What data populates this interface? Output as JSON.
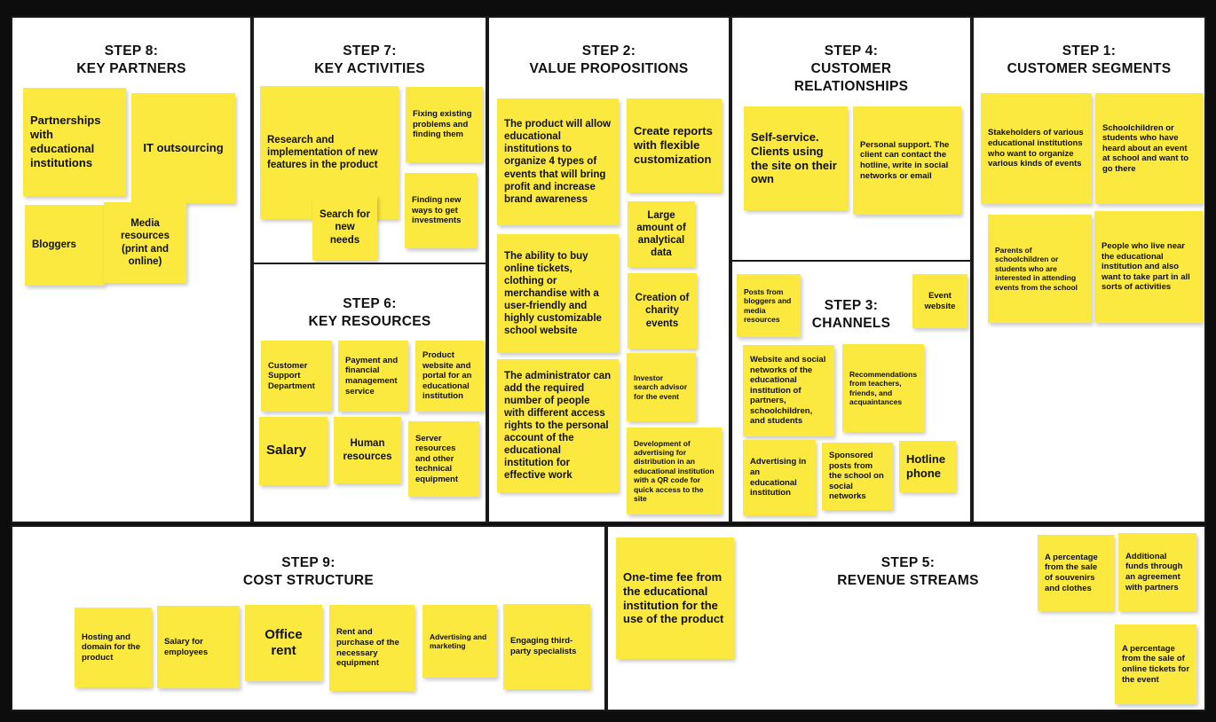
{
  "canvas": {
    "name": "Business Model Canvas",
    "note_color": "#fbe93f",
    "panel_bg": "#ffffff",
    "frame_color": "#0d0d0d"
  },
  "panels": [
    {
      "id": "step8",
      "title": "STEP 8:\nKEY PARTNERS",
      "notes": [
        {
          "text": "Partnerships with educational institutions"
        },
        {
          "text": "IT outsourcing"
        },
        {
          "text": "Bloggers"
        },
        {
          "text": "Media resources (print and online)"
        }
      ]
    },
    {
      "id": "step7",
      "title": "STEP 7:\nKEY ACTIVITIES",
      "notes": [
        {
          "text": "Research and implementation of new features in the product"
        },
        {
          "text": "Fixing existing problems and finding them"
        },
        {
          "text": "Search for new needs"
        },
        {
          "text": "Finding new ways to get investments"
        }
      ]
    },
    {
      "id": "step6",
      "title": "STEP 6:\nKEY RESOURCES",
      "notes": [
        {
          "text": "Customer Support Department"
        },
        {
          "text": "Payment and financial management service"
        },
        {
          "text": "Product website and portal for an educational institution"
        },
        {
          "text": "Salary"
        },
        {
          "text": "Human resources"
        },
        {
          "text": "Server resources and other technical equipment"
        }
      ]
    },
    {
      "id": "step2",
      "title": "STEP 2:\nVALUE PROPOSITIONS",
      "notes": [
        {
          "text": "The product will allow educational institutions to organize 4 types of events that will bring profit and increase brand awareness"
        },
        {
          "text": "Create reports with flexible customization"
        },
        {
          "text": "Large amount of analytical data"
        },
        {
          "text": "The ability to buy online tickets, clothing or merchandise with a user-friendly and highly customizable school website"
        },
        {
          "text": "Creation of charity events"
        },
        {
          "text": "The administrator can add the required number of people with different access rights to the personal account of the educational institution for effective work"
        },
        {
          "text": "Investor search advisor for the event"
        },
        {
          "text": "Development of advertising for distribution in an educational institution with a QR code for quick access to the site"
        }
      ]
    },
    {
      "id": "step4",
      "title": "STEP 4:\nCUSTOMER\nRELATIONSHIPS",
      "notes": [
        {
          "text": "Self-service. Clients using the site on their own"
        },
        {
          "text": "Personal support. The client can contact the hotline, write in social networks or email"
        }
      ]
    },
    {
      "id": "step3",
      "title": "STEP 3:\nCHANNELS",
      "notes": [
        {
          "text": "Posts from bloggers and media resources"
        },
        {
          "text": "Event website"
        },
        {
          "text": "Website and social networks of the educational institution of partners, schoolchildren, and students"
        },
        {
          "text": "Recommendations from teachers, friends, and acquaintances"
        },
        {
          "text": "Advertising in an educational institution"
        },
        {
          "text": "Sponsored posts from the school on social networks"
        },
        {
          "text": "Hotline phone"
        }
      ]
    },
    {
      "id": "step1",
      "title": "STEP 1:\nCUSTOMER SEGMENTS",
      "notes": [
        {
          "text": "Stakeholders of various educational institutions who want to organize various kinds of events"
        },
        {
          "text": "Schoolchildren or students who have heard about an event at school and want to go there"
        },
        {
          "text": "Parents of schoolchildren or students who are interested in attending events from the school"
        },
        {
          "text": "People who live near the educational institution and also want to take part in all sorts of activities"
        }
      ]
    },
    {
      "id": "step9",
      "title": "STEP 9:\nCOST STRUCTURE",
      "notes": [
        {
          "text": "Hosting and domain for the product"
        },
        {
          "text": "Salary for employees"
        },
        {
          "text": "Office rent"
        },
        {
          "text": "Rent and purchase of the necessary equipment"
        },
        {
          "text": "Advertising and marketing"
        },
        {
          "text": "Engaging third-party specialists"
        }
      ]
    },
    {
      "id": "step5",
      "title": "STEP 5:\nREVENUE STREAMS",
      "notes": [
        {
          "text": "One-time fee from the educational institution for the use of the product"
        },
        {
          "text": "A percentage from the sale of souvenirs and clothes"
        },
        {
          "text": "Additional funds through an agreement with partners"
        },
        {
          "text": "A percentage from the sale of online tickets for the event"
        }
      ]
    }
  ]
}
